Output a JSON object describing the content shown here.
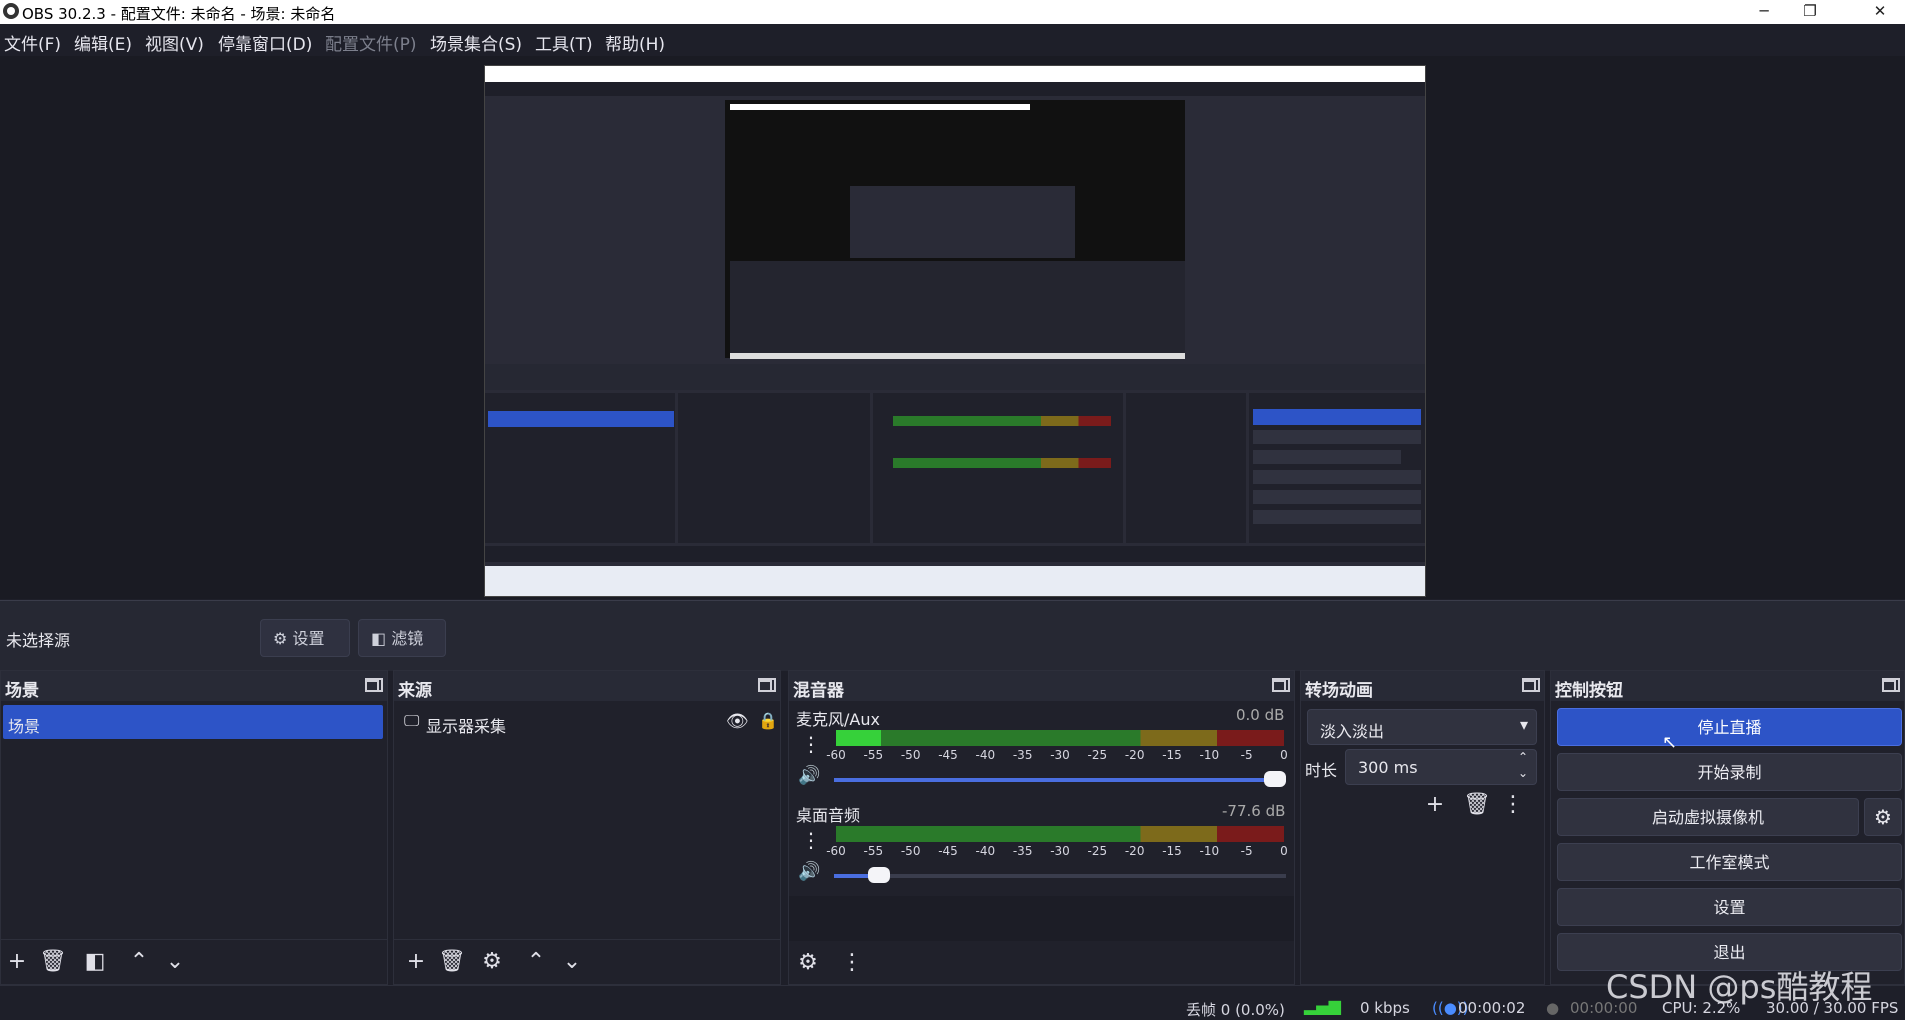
{
  "window": {
    "title": "OBS 30.2.3 - 配置文件: 未命名 - 场景: 未命名",
    "minimize": "─",
    "restore": "❐",
    "close": "✕"
  },
  "menu": [
    {
      "label": "文件(F)"
    },
    {
      "label": "编辑(E)"
    },
    {
      "label": "视图(V)"
    },
    {
      "label": "停靠窗口(D)"
    },
    {
      "label": "配置文件(P)"
    },
    {
      "label": "场景集合(S)"
    },
    {
      "label": "工具(T)"
    },
    {
      "label": "帮助(H)"
    }
  ],
  "source_toolbar": {
    "no_source": "未选择源",
    "settings": "设置",
    "filters": "滤镜"
  },
  "scenes": {
    "title": "场景",
    "items": [
      "场景"
    ]
  },
  "sources": {
    "title": "来源",
    "items": [
      "显示器采集"
    ]
  },
  "mixer": {
    "title": "混音器",
    "channels": [
      {
        "name": "麦克风/Aux",
        "db": "0.0 dB",
        "level": 0.1,
        "volume": 1.0
      },
      {
        "name": "桌面音频",
        "db": "-77.6 dB",
        "level": 0.0,
        "volume": 0.1
      }
    ],
    "ticks": [
      "-60",
      "-55",
      "-50",
      "-45",
      "-40",
      "-35",
      "-30",
      "-25",
      "-20",
      "-15",
      "-10",
      "-5",
      "0"
    ]
  },
  "transitions": {
    "title": "转场动画",
    "selected": "淡入淡出",
    "duration_label": "时长",
    "duration_value": "300 ms"
  },
  "controls": {
    "title": "控制按钮",
    "stop_stream": "停止直播",
    "start_record": "开始录制",
    "virtual_cam": "启动虚拟摄像机",
    "studio_mode": "工作室模式",
    "settings": "设置",
    "exit": "退出"
  },
  "status": {
    "dropped": "丢帧 0 (0.0%)",
    "bitrate": "0 kbps",
    "stream_time": "00:00:02",
    "record_time": "00:00:00",
    "cpu": "CPU: 2.2%",
    "fps": "30.00 / 30.00 FPS"
  },
  "watermark": "CSDN @ps酷教程",
  "colors": {
    "accent": "#2d54c7",
    "bg": "#1e1f29",
    "panel": "#20212b"
  }
}
